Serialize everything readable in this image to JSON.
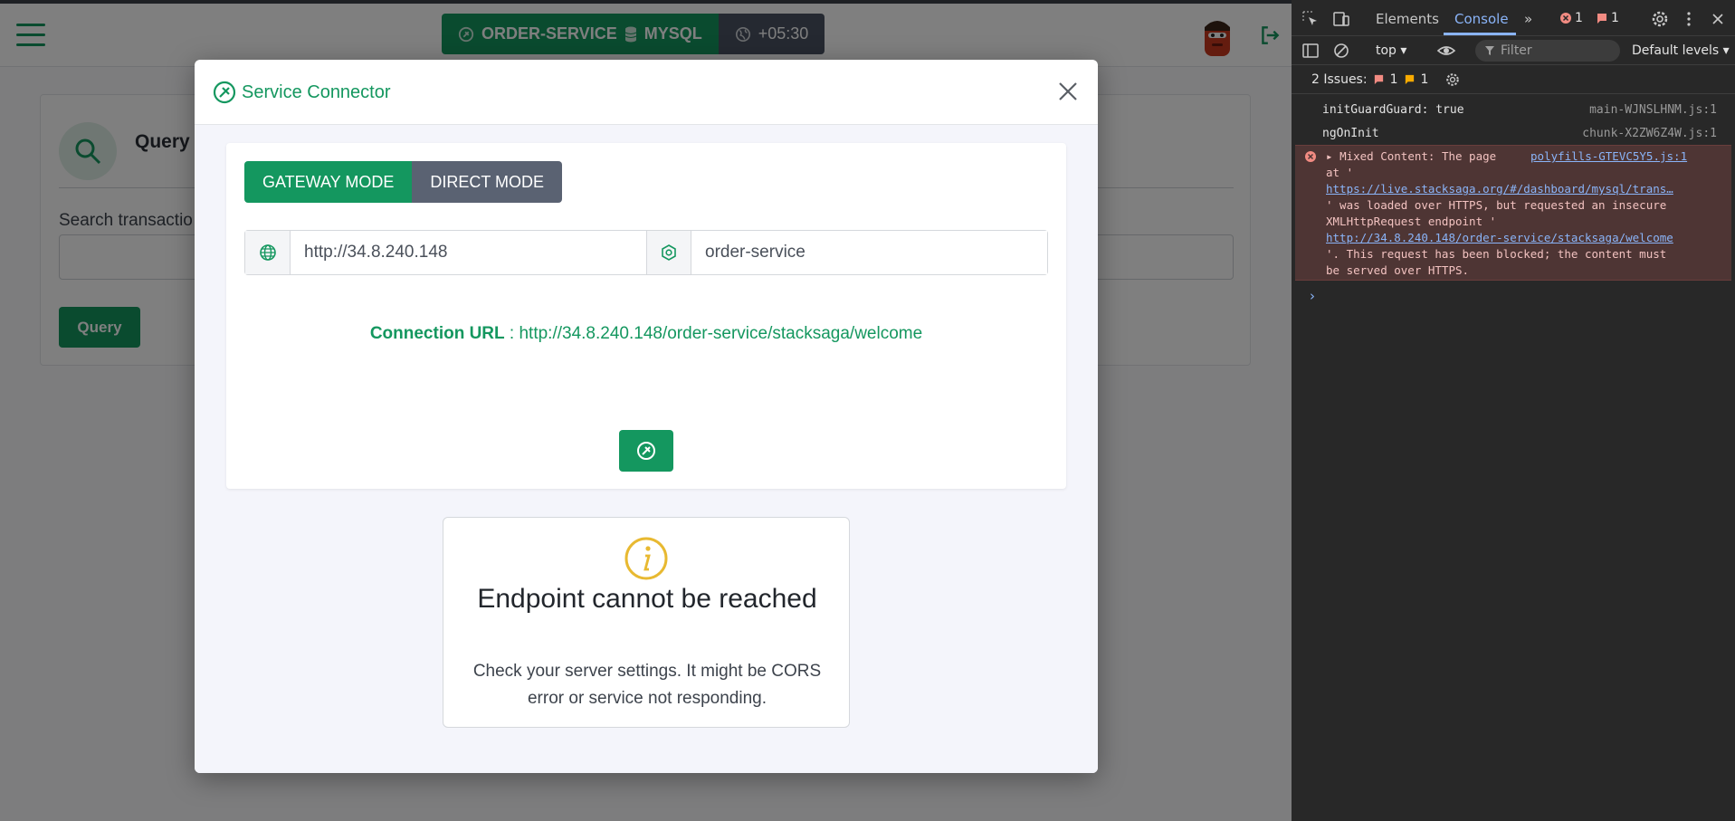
{
  "app": {
    "service_label": "ORDER-SERVICE",
    "db_label": "MYSQL",
    "timezone": "+05:30",
    "card": {
      "title": "Query",
      "search_label": "Search transactio",
      "query_button": "Query"
    }
  },
  "modal": {
    "title": "Service Connector",
    "modes": [
      "GATEWAY MODE",
      "DIRECT MODE"
    ],
    "active_mode": "GATEWAY MODE",
    "host_value": "http://34.8.240.148",
    "service_value": "order-service",
    "connection_label": "Connection URL",
    "connection_sep": " : ",
    "connection_url": "http://34.8.240.148/order-service/stacksaga/welcome",
    "error": {
      "title": "Endpoint cannot be reached",
      "message": "Check your server settings. It might be CORS error or service not responding."
    }
  },
  "devtools": {
    "tabs": [
      "Elements",
      "Console"
    ],
    "active_tab": "Console",
    "error_count": "1",
    "issue_count": "1",
    "context": "top",
    "filter_placeholder": "Filter",
    "levels": "Default levels",
    "issues_label": "2 Issues:",
    "issues_errors": "1",
    "issues_warnings": "1",
    "logs": [
      {
        "msg": "initGuardGuard: true",
        "src": "main-WJNSLHNM.js:1"
      },
      {
        "msg": "ngOnInit",
        "src": "chunk-X2ZW6Z4W.js:1"
      }
    ],
    "error_log": {
      "prefix": "Mixed Content: The page",
      "src": "polyfills-GTEVC5Y5.js:1",
      "at": "at '",
      "page_url": "https://live.stacksaga.org/#/dashboard/mysql/trans…",
      "mid1": "' was loaded over HTTPS, but requested an insecure",
      "mid2": "XMLHttpRequest endpoint '",
      "endpoint": "http://34.8.240.148/order-service/stacksaga/welcome",
      "tail1": "'. This request has been blocked; the content must",
      "tail2": "be served over HTTPS."
    }
  },
  "colors": {
    "accent": "#14975f",
    "secondary": "#5a6272",
    "devtools_bg": "#282828",
    "error_bg": "#4e3534",
    "link": "#8ab4f8"
  }
}
